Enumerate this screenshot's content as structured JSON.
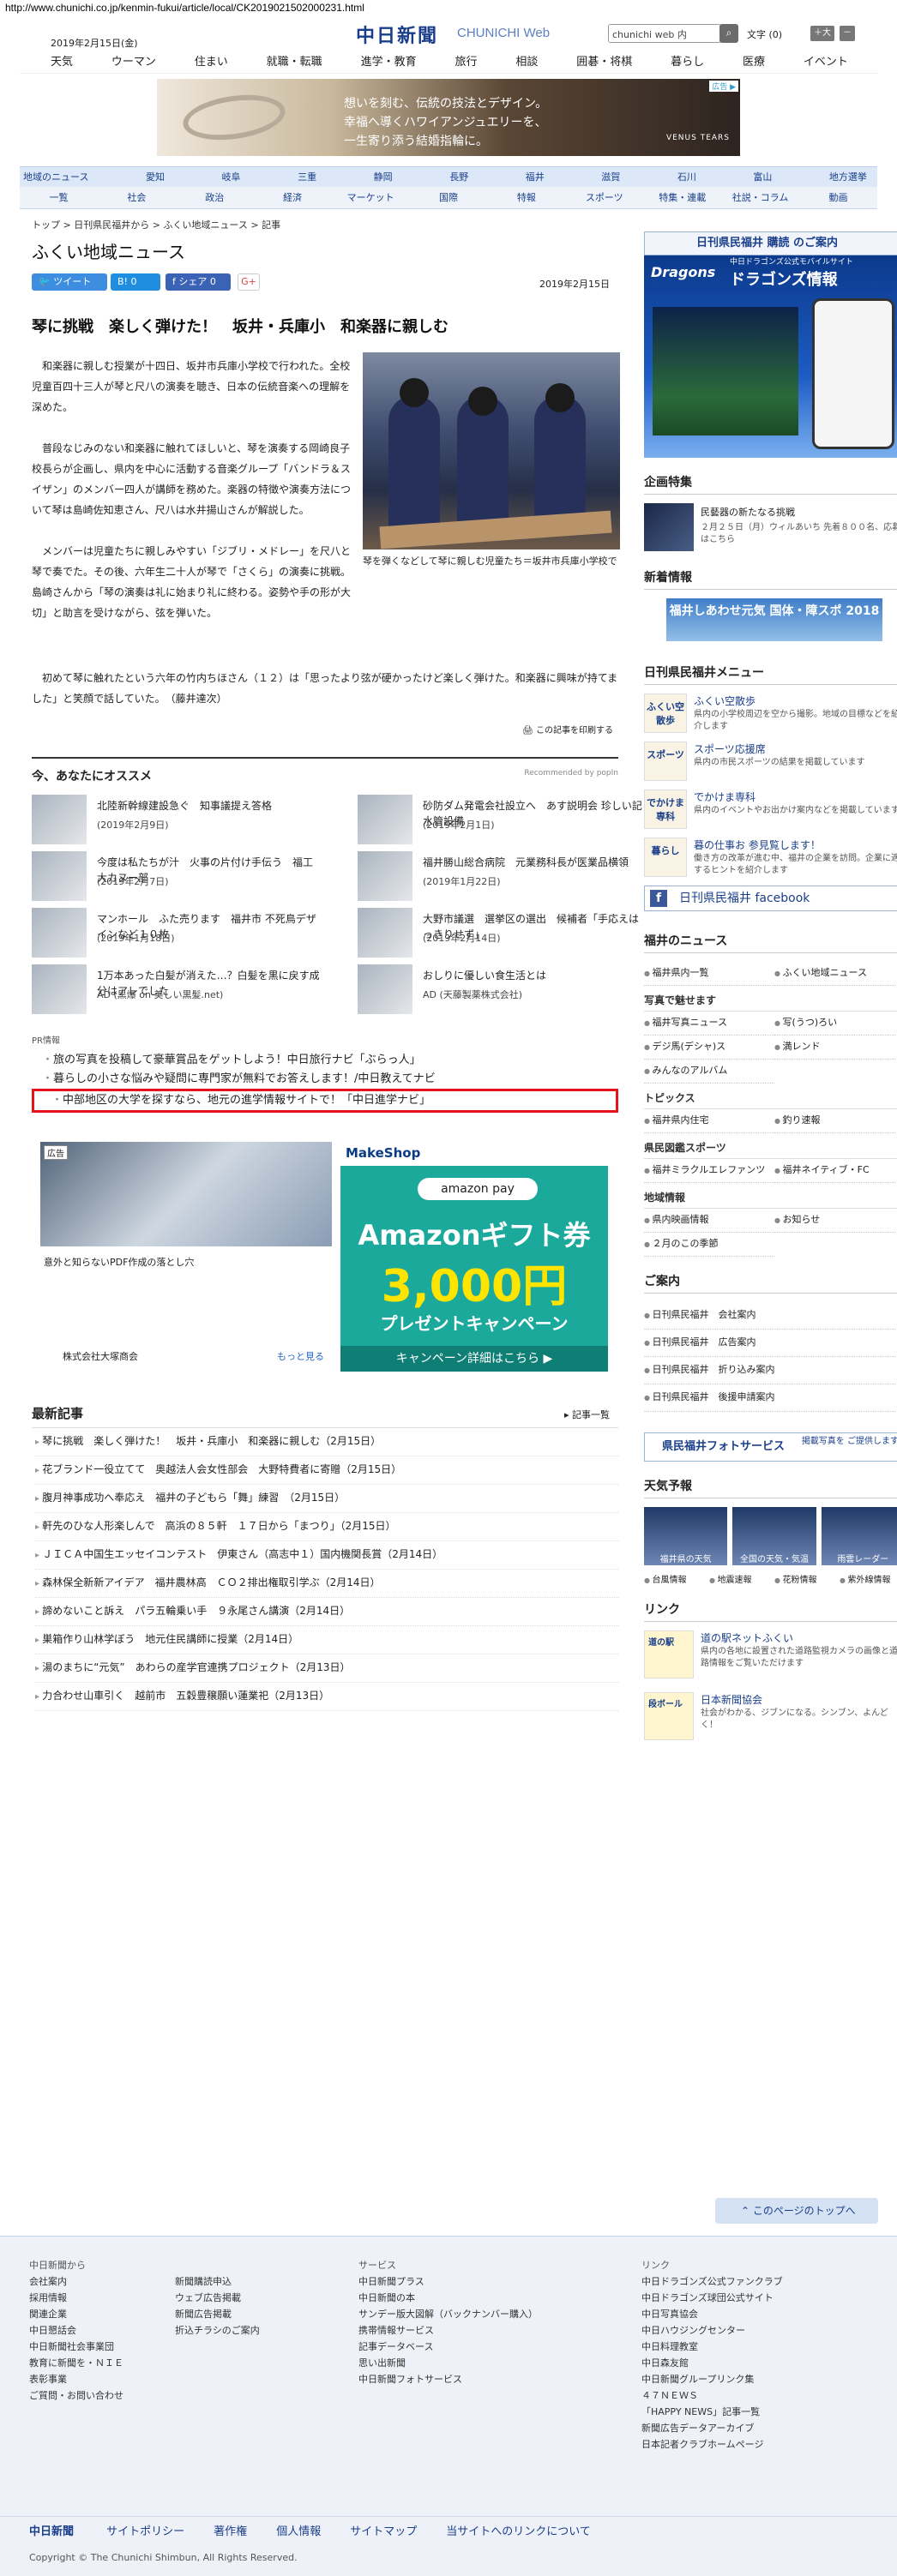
{
  "url": "http://www.chunichi.co.jp/kenmin-fukui/article/local/CK2019021502000231.html",
  "header": {
    "date": "2019年2月15日(金)",
    "logo": "中日新聞",
    "logo_en": "CHUNICHI Web",
    "search_placeholder": "chunichi web 内",
    "search_icon": "search-icon",
    "font_size_label": "文字",
    "font_size_value": "(0)",
    "font_size_plus": "＋大",
    "font_size_minus": "－"
  },
  "topnav": [
    "天気",
    "ウーマン",
    "住まい",
    "就職・転職",
    "進学・教育",
    "旅行",
    "相談",
    "囲碁・将棋",
    "暮らし",
    "医療",
    "イベント"
  ],
  "ad1": {
    "tag": "広告 ▶",
    "line1": "想いを刻む、伝統の技法とデザイン。",
    "line2": "幸福へ導くハワイアンジュエリーを、",
    "line3": "一生寄り添う結婚指輪に。",
    "brand": "VENUS TEARS"
  },
  "nav2": [
    "地域のニュース",
    "愛知",
    "岐阜",
    "三重",
    "静岡",
    "長野",
    "福井",
    "滋賀",
    "石川",
    "富山",
    "地方選挙"
  ],
  "nav3": [
    "一覧",
    "社会",
    "政治",
    "経済",
    "マーケット",
    "国際",
    "特報",
    "スポーツ",
    "特集・連載",
    "社説・コラム",
    "動画"
  ],
  "breadcrumb": "トップ > 日刊県民福井から > ふくい地域ニュース > 記事",
  "page_title": "ふくい地域ニュース",
  "share": {
    "tweet": "ツイート",
    "hatena": "B! 0",
    "facebook": "シェア 0",
    "google": "G+"
  },
  "article": {
    "date": "2019年2月15日",
    "headline": "琴に挑戦　楽しく弾けた！　坂井・兵庫小　和楽器に親しむ",
    "p1": "和楽器に親しむ授業が十四日、坂井市兵庫小学校で行われた。全校児童百四十三人が琴と尺八の演奏を聴き、日本の伝統音楽への理解を深めた。",
    "p2": "普段なじみのない和楽器に触れてほしいと、琴を演奏する岡崎良子校長らが企画し、県内を中心に活動する音楽グループ「バンドラ＆スイザン」のメンバー四人が講師を務めた。楽器の特徴や演奏方法について琴は島崎佐知恵さん、尺八は水井揚山さんが解説した。",
    "p3": "メンバーは児童たちに親しみやすい「ジブリ・メドレー」を尺八と琴で奏でた。その後、六年生二十人が琴で「さくら」の演奏に挑戦。島崎さんから「琴の演奏は礼に始まり礼に終わる。姿勢や手の形が大切」と助言を受けながら、弦を弾いた。",
    "p4": "初めて琴に触れたという六年の竹内ちほさん（１２）は「思ったより弦が硬かったけど楽しく弾けた。和楽器に興味が持てました」と笑顔で話していた。　（藤井達次）",
    "caption": "琴を弾くなどして琴に親しむ児童たち＝坂井市兵庫小学校で",
    "print": "この記事を印刷する"
  },
  "osusume": {
    "title": "今、あなたにオススメ",
    "recommended": "Recommended by popIn",
    "items": [
      {
        "title": "北陸新幹線建設急ぐ　知事議提え答格",
        "sub": "(2019年2月9日)"
      },
      {
        "title": "砂防ダム発電会社設立へ　あす説明会 珍しい記水管設備",
        "sub": "(2019年2月1日)"
      },
      {
        "title": "今度は私たちが汁　火事の片付け手伝う　福工大カヌー部",
        "sub": "(2019年2月7日)"
      },
      {
        "title": "福井勝山総合病院　元業務科長が医業品横領",
        "sub": "(2019年1月22日)"
      },
      {
        "title": "マンホール　ふた売ります　福井市 不死鳥デザインなど１０枚",
        "sub": "(2019年1月18日)"
      },
      {
        "title": "大野市議選　選挙区の選出　候補者「手応えはっきりせず」",
        "sub": "(2019年2月14日)"
      },
      {
        "title": "1万本あった白髪が消えた…？白髪を黒に戻す成分はアレでした",
        "sub": "AD (黒爆 on 美しい黒髪.net)"
      },
      {
        "title": "おしりに優しい食生活とは",
        "sub": "AD (天藤製薬株式会社)"
      }
    ]
  },
  "pr": {
    "label": "PR情報",
    "items": [
      "旅の写真を投稿して豪華賞品をゲットしよう！中日旅行ナビ「ぶらっ人」",
      "暮らしの小さな悩みや疑問に専門家が無料でお答えします！/中日教えてナビ"
    ],
    "highlight": "中部地区の大学を探すなら、地元の進学情報サイトで！「中日進学ナビ」"
  },
  "ad2": {
    "tag": "広告",
    "caption": "意外と知らないPDF作成の落とし穴",
    "company": "株式会社大塚商会",
    "more": "もっと見る"
  },
  "ad3": {
    "shop": "MakeShop",
    "pay": "amazon pay",
    "gift": "Amazonギフト券",
    "amount": "3,000円",
    "campaign": "プレゼントキャンペーン",
    "detail": "キャンペーン詳細はこちら ▶"
  },
  "latest": {
    "title": "最新記事",
    "list_link": "記事一覧",
    "items": [
      "琴に挑戦　楽しく弾けた！　坂井・兵庫小　和楽器に親しむ（2月15日）",
      "花ブランド一役立てて　奥越法人会女性部会　大野特費者に寄贈（2月15日）",
      "腹月神事成功へ奉応え　福井の子どもら「舞」練習　（2月15日）",
      "軒先のひな人形楽しんで　高浜の８５軒　１７日から「まつり」（2月15日）",
      "ＪＩＣＡ中国生エッセイコンテスト　伊東さん（高志中１）国内機関長賞（2月14日）",
      "森林保全新新アイデア　福井農林高　ＣＯ２排出権取引学ぶ（2月14日）",
      "諦めないこと訴え　パラ五輪乗い手　９永尾さん講演（2月14日）",
      "巣箱作り山林学ぼう　地元住民講師に授業（2月14日）",
      "湯のまちに“元気”　あわらの産学官連携プロジェクト（2月13日）",
      "力合わせ山車引く　越前市　五穀豊穣願い蓮業祀（2月13日）"
    ]
  },
  "side": {
    "kodoku": "日刊県民福井 購読 のご案内",
    "dragons_logo": "Dragons",
    "dragons_title": "ドラゴンズ情報",
    "dragons_sub": "中日ドラゴンズ公式モバイルサイト",
    "kikaku_title": "企画特集",
    "kikaku_t1": "民藝器の新たなる挑戦",
    "kikaku_t2": "２月２５日（月）ウィルあいち 先着８００名、応募はこちら",
    "shinchaku_title": "新着情報",
    "shinchaku_banner": "福井しあわせ元気 国体・障スポ 2018",
    "menu_title": "日刊県民福井メニュー",
    "menu": [
      {
        "icon": "ふくい空散歩",
        "t1": "ふくい空散歩",
        "t2": "県内の小学校周辺を空から撮影。地域の目標などを紹介します"
      },
      {
        "icon": "スポーツ",
        "t1": "スポーツ応援席",
        "t2": "県内の市民スポーツの結果を掲載しています"
      },
      {
        "icon": "でかけま専科",
        "t1": "でかけま専科",
        "t2": "県内のイベントやお出かけ案内などを掲載しています"
      },
      {
        "icon": "暮らし",
        "t1": "暮の仕事お 参見覧します！",
        "t2": "働き方の改革が進む中、福井の企業を訪問。企業に適するヒントを紹介します"
      }
    ],
    "facebook": "日刊県民福井 facebook",
    "news_title": "福井のニュース",
    "news_row1": [
      "福井県内一覧",
      "ふくい地域ニュース"
    ],
    "photo_title": "写真で魅せます",
    "photo_row": [
      "福井写真ニュース",
      "写(うつ)ろい",
      "デジ馬(デシャ)ス",
      "満レンド",
      "みんなのアルバム"
    ],
    "topics_title": "トピックス",
    "topics_row": [
      "福井県内住宅",
      "釣り速報"
    ],
    "sports_title": "県民図鑑スポーツ",
    "sports_row": [
      "福井ミラクルエレファンツ",
      "福井ネイティブ・FC"
    ],
    "chiiki_title": "地域情報",
    "chiiki_row": [
      "県内映画情報",
      "お知らせ",
      "２月のこの季節"
    ],
    "annai_title": "ご案内",
    "annai": [
      "日刊県民福井　会社案内",
      "日刊県民福井　広告案内",
      "日刊県民福井　折り込み案内",
      "日刊県民福井　後援申請案内"
    ],
    "photosvc": "県民福井フォトサービス",
    "photosvc_sub": "掲載写真を ご提供します",
    "weather_title": "天気予報",
    "weather": [
      "福井県の天気",
      "全国の天気・気温",
      "雨雲レーダー"
    ],
    "weather_links": [
      "台風情報",
      "地震速報",
      "花粉情報",
      "紫外線情報"
    ],
    "link_title": "リンク",
    "links": [
      {
        "icon": "道の駅",
        "t1": "道の駅ネットふくい",
        "t2": "県内の各地に設置された道路監視カメラの画像と道路情報をご覧いただけます"
      },
      {
        "icon": "段ボール",
        "t1": "日本新聞協会",
        "t2": "社会がわかる、ジブンになる。シンブン、よんどく！"
      }
    ]
  },
  "to_top": "このページのトップへ",
  "footer": {
    "col1_title": "中日新聞から",
    "col1": [
      "会社案内",
      "採用情報",
      "関連企業",
      "中日懇話会",
      "中日新聞社会事業団",
      "教育に新聞を・ＮＩＥ",
      "表彰事業",
      "ご質問・お問い合わせ"
    ],
    "col2": [
      "新聞購読申込",
      "ウェブ広告掲載",
      "新聞広告掲載",
      "折込チラシのご案内"
    ],
    "col3_title": "サービス",
    "col3": [
      "中日新聞プラス",
      "中日新聞の本",
      "サンデー版大図解（バックナンバー購入）",
      "携帯情報サービス",
      "記事データベース",
      "思い出新聞",
      "中日新聞フォトサービス"
    ],
    "col4_title": "リンク",
    "col4": [
      "中日ドラゴンズ公式ファンクラブ",
      "中日ドラゴンズ球団公式サイト",
      "中日写真協会",
      "中日ハウジングセンター",
      "中日料理教室",
      "中日森友館",
      "中日新聞グループリンク集",
      "４７ＮＥＷＳ",
      "「HAPPY NEWS」記事一覧",
      "新聞広告データアーカイブ",
      "日本記者クラブホームページ"
    ],
    "bar": [
      "サイトポリシー",
      "著作権",
      "個人情報",
      "サイトマップ",
      "当サイトへのリンクについて"
    ],
    "bar_logo": "中日新聞",
    "copyright": "Copyright © The Chunichi Shimbun, All Rights Reserved."
  }
}
